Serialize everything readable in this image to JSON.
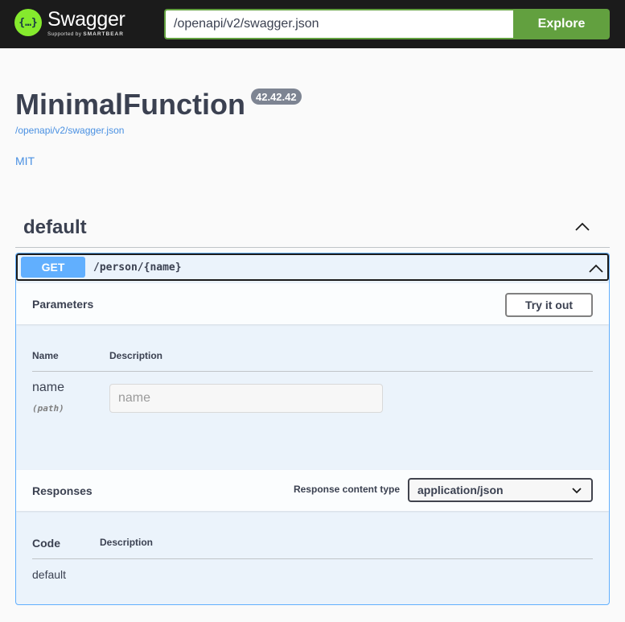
{
  "topbar": {
    "logo_glyph": "{…}",
    "logo_title": "Swagger",
    "logo_sub_prefix": "Supported by",
    "logo_sub_brand": "SMARTBEAR",
    "url_value": "/openapi/v2/swagger.json",
    "explore_label": "Explore",
    "accent_color": "#62a03f"
  },
  "info": {
    "title": "MinimalFunction",
    "version": "42.42.42",
    "spec_url": "/openapi/v2/swagger.json",
    "license": "MIT"
  },
  "tag": {
    "name": "default",
    "toggle_icon": "chevron-up-icon"
  },
  "operation": {
    "method": "GET",
    "path": "/person/{name}",
    "method_color": "#61affe",
    "toggle_icon": "chevron-up-icon",
    "parameters": {
      "title": "Parameters",
      "try_label": "Try it out",
      "col_name": "Name",
      "col_description": "Description",
      "rows": [
        {
          "name": "name",
          "in": "(path)",
          "placeholder": "name"
        }
      ]
    },
    "responses": {
      "title": "Responses",
      "content_type_label": "Response content type",
      "content_type_value": "application/json",
      "col_code": "Code",
      "col_description": "Description",
      "rows": [
        {
          "code": "default"
        }
      ]
    }
  }
}
